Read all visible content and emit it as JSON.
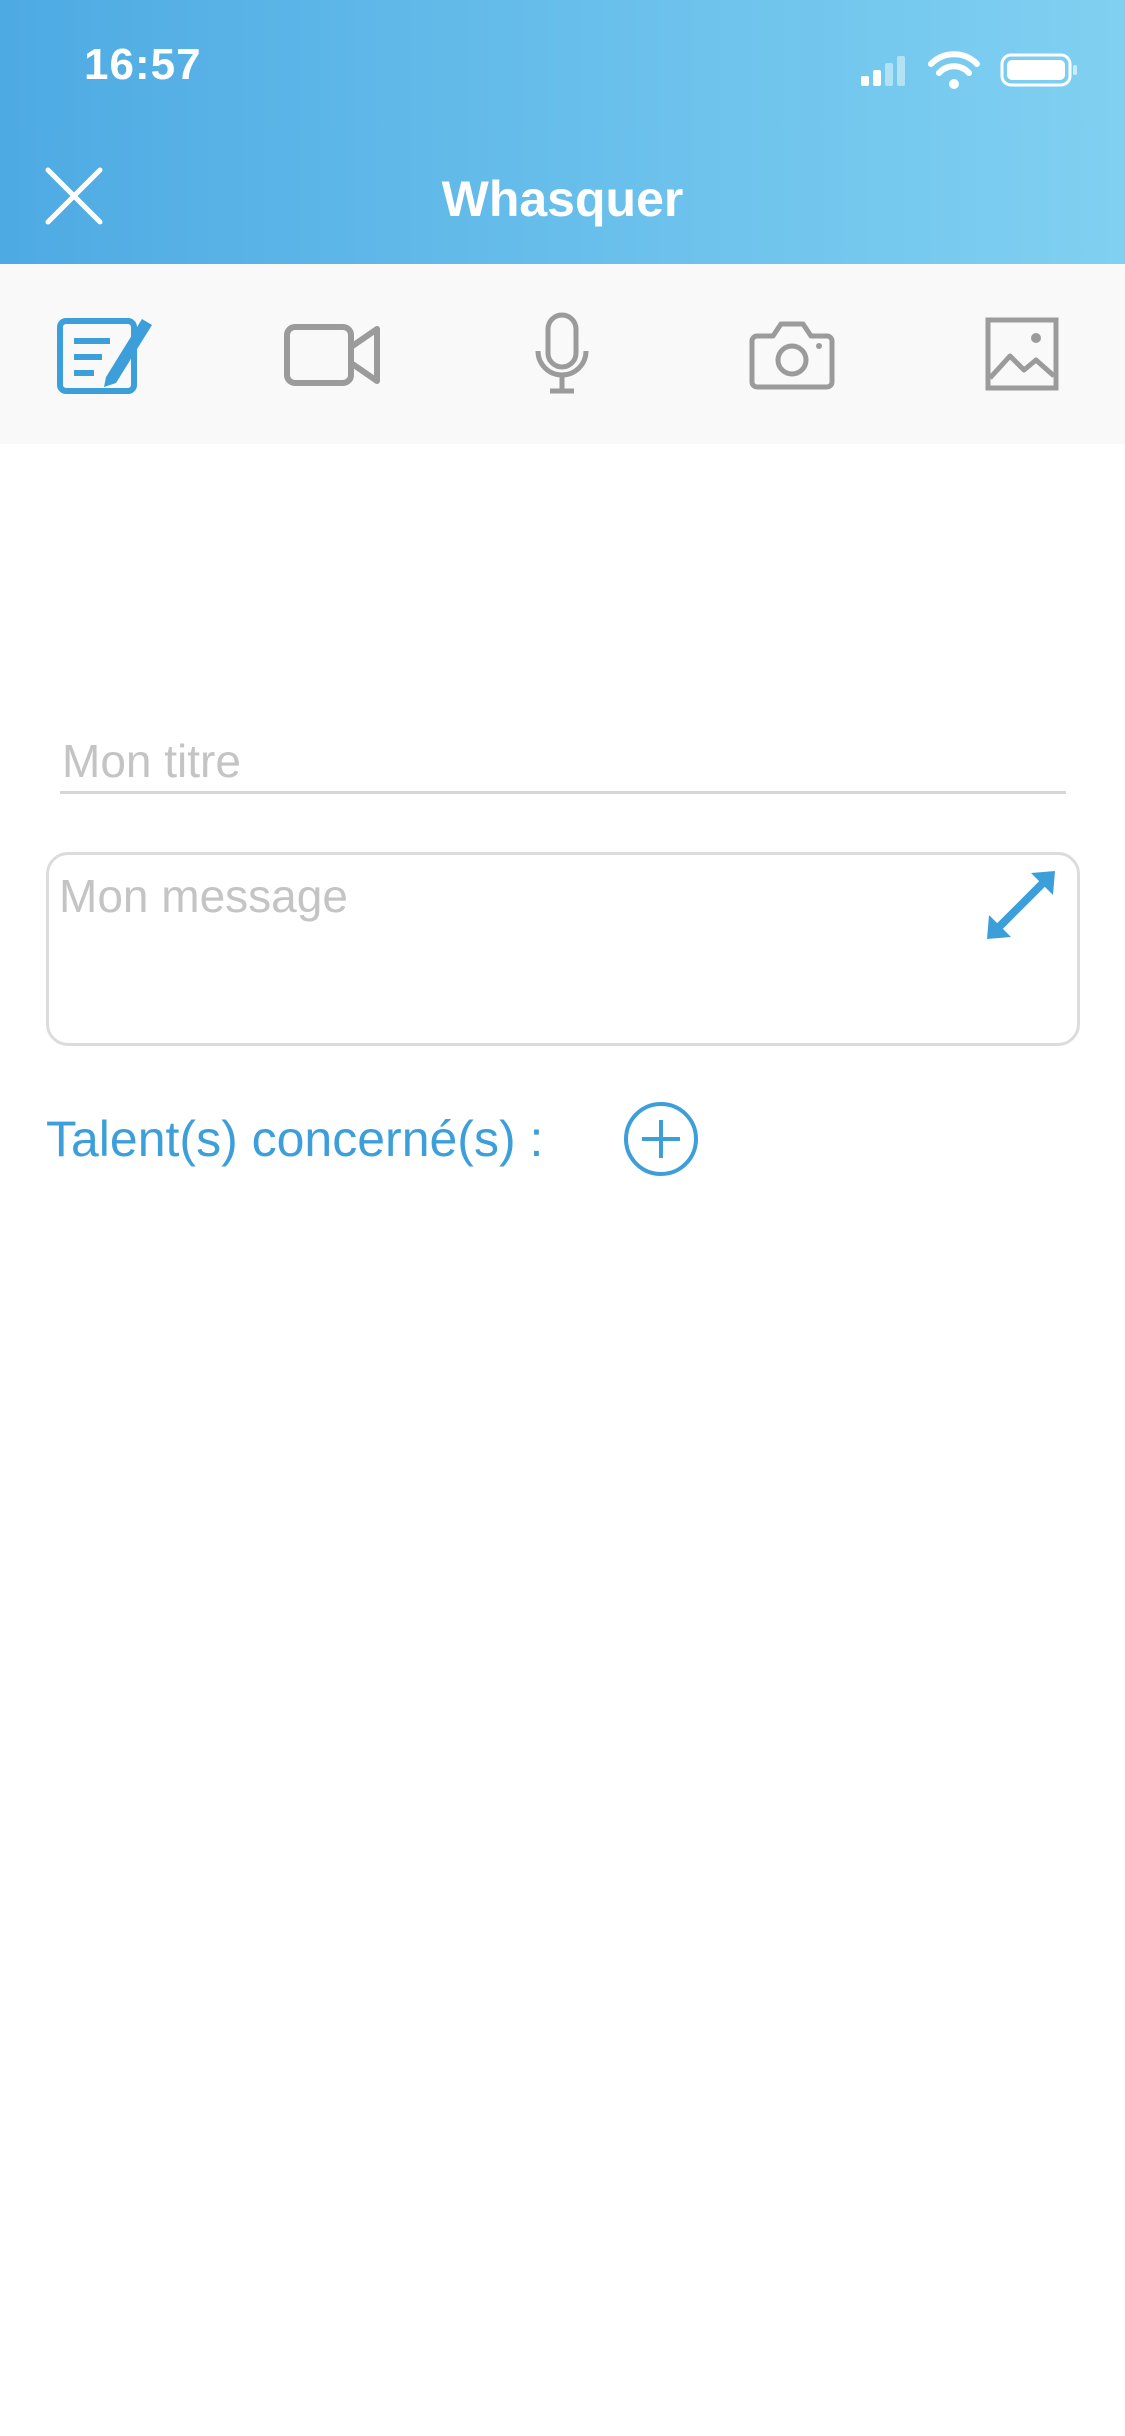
{
  "status_bar": {
    "time": "16:57"
  },
  "header": {
    "title": "Whasquer",
    "close_icon": "close-icon"
  },
  "toolbar": {
    "items": [
      {
        "icon": "note-edit-icon",
        "active": true
      },
      {
        "icon": "video-camera-icon",
        "active": false
      },
      {
        "icon": "microphone-icon",
        "active": false
      },
      {
        "icon": "camera-icon",
        "active": false
      },
      {
        "icon": "image-icon",
        "active": false
      }
    ]
  },
  "form": {
    "title_placeholder": "Mon titre",
    "title_value": "",
    "message_placeholder": "Mon message",
    "message_value": "",
    "talent_label": "Talent(s) concerné(s) :"
  },
  "colors": {
    "header_gradient_start": "#4eaae3",
    "header_gradient_end": "#80d0f1",
    "accent": "#3d9fd9",
    "icon_inactive": "#9b9b9b",
    "placeholder": "#c4c4c4"
  }
}
